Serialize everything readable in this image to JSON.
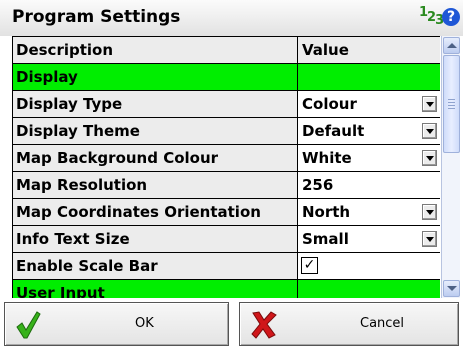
{
  "window": {
    "title": "Program Settings",
    "numbers_icon": "numbers-icon",
    "help_icon": "help-icon",
    "help_glyph": "?"
  },
  "table": {
    "columns": [
      "Description",
      "Value"
    ],
    "rows": [
      {
        "type": "category",
        "description": "Display",
        "value": ""
      },
      {
        "type": "dropdown",
        "description": "Display Type",
        "value": "Colour"
      },
      {
        "type": "dropdown",
        "description": "Display Theme",
        "value": "Default"
      },
      {
        "type": "dropdown",
        "description": "Map Background Colour",
        "value": "White"
      },
      {
        "type": "text",
        "description": "Map Resolution",
        "value": "256"
      },
      {
        "type": "dropdown",
        "description": "Map Coordinates Orientation",
        "value": "North"
      },
      {
        "type": "dropdown",
        "description": "Info Text Size",
        "value": "Small"
      },
      {
        "type": "checkbox",
        "description": "Enable Scale Bar",
        "value": "✓"
      },
      {
        "type": "category",
        "description": "User Input",
        "value": ""
      }
    ]
  },
  "buttons": {
    "ok_label": "OK",
    "cancel_label": "Cancel"
  },
  "colors": {
    "category_row": "#00ee00",
    "ok_icon": "#37b21a",
    "cancel_icon": "#d0161a"
  }
}
